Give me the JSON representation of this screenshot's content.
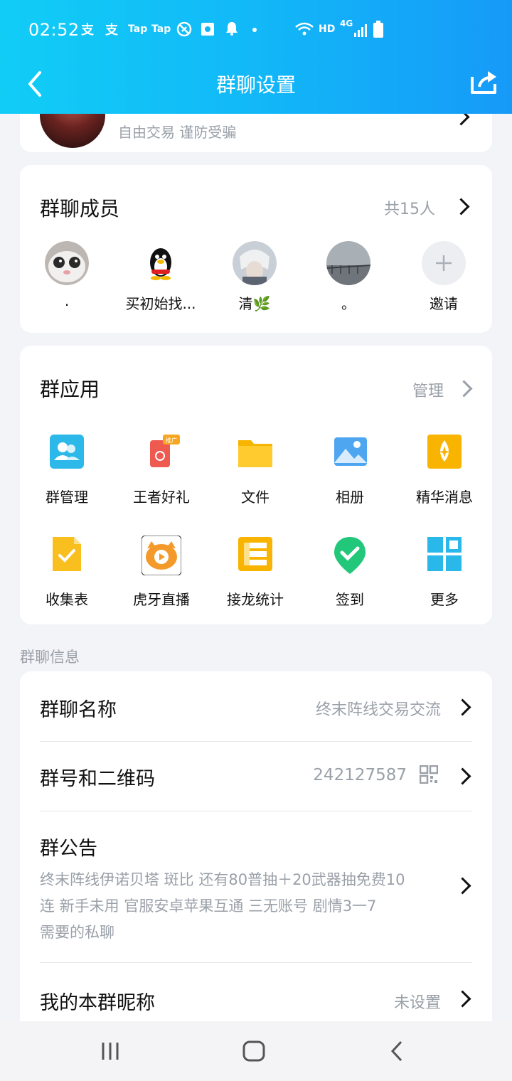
{
  "status_bar": {
    "time": "02:52",
    "icon_texts": [
      "支",
      "支",
      "Tap",
      "Tap"
    ],
    "network": "HD",
    "cell": "4G"
  },
  "nav": {
    "title": "群聊设置"
  },
  "group_header": {
    "subtitle": "自由交易 谨防受骗"
  },
  "members": {
    "title": "群聊成员",
    "count": "共15人",
    "items": [
      {
        "name": "."
      },
      {
        "name": "买初始找..."
      },
      {
        "name": "清🌿"
      },
      {
        "name": "。"
      },
      {
        "name": "邀请"
      }
    ]
  },
  "apps": {
    "title": "群应用",
    "manage": "管理",
    "badge": "推广",
    "items": [
      {
        "label": "群管理",
        "icon": "group-manage-icon"
      },
      {
        "label": "王者好礼",
        "icon": "gift-icon"
      },
      {
        "label": "文件",
        "icon": "folder-icon"
      },
      {
        "label": "相册",
        "icon": "album-icon"
      },
      {
        "label": "精华消息",
        "icon": "essence-icon"
      },
      {
        "label": "收集表",
        "icon": "form-icon"
      },
      {
        "label": "虎牙直播",
        "icon": "huya-icon"
      },
      {
        "label": "接龙统计",
        "icon": "relay-icon"
      },
      {
        "label": "签到",
        "icon": "checkin-icon"
      },
      {
        "label": "更多",
        "icon": "more-icon"
      }
    ]
  },
  "info": {
    "section_label": "群聊信息",
    "name_label": "群聊名称",
    "name_value": "终末阵线交易交流",
    "id_label": "群号和二维码",
    "id_value": "242127587",
    "notice_label": "群公告",
    "notice_lines": [
      "终末阵线伊诺贝塔 斑比 还有80普抽＋20武器抽免费10",
      "连 新手未用 官服安卓苹果互通 三无账号 剧情3一7",
      "需要的私聊"
    ],
    "nickname_label": "我的本群昵称",
    "nickname_value": "未设置"
  },
  "colors": {
    "header_start": "#11cdf6",
    "header_end": "#169af8",
    "text_muted": "#9aa0a8"
  }
}
